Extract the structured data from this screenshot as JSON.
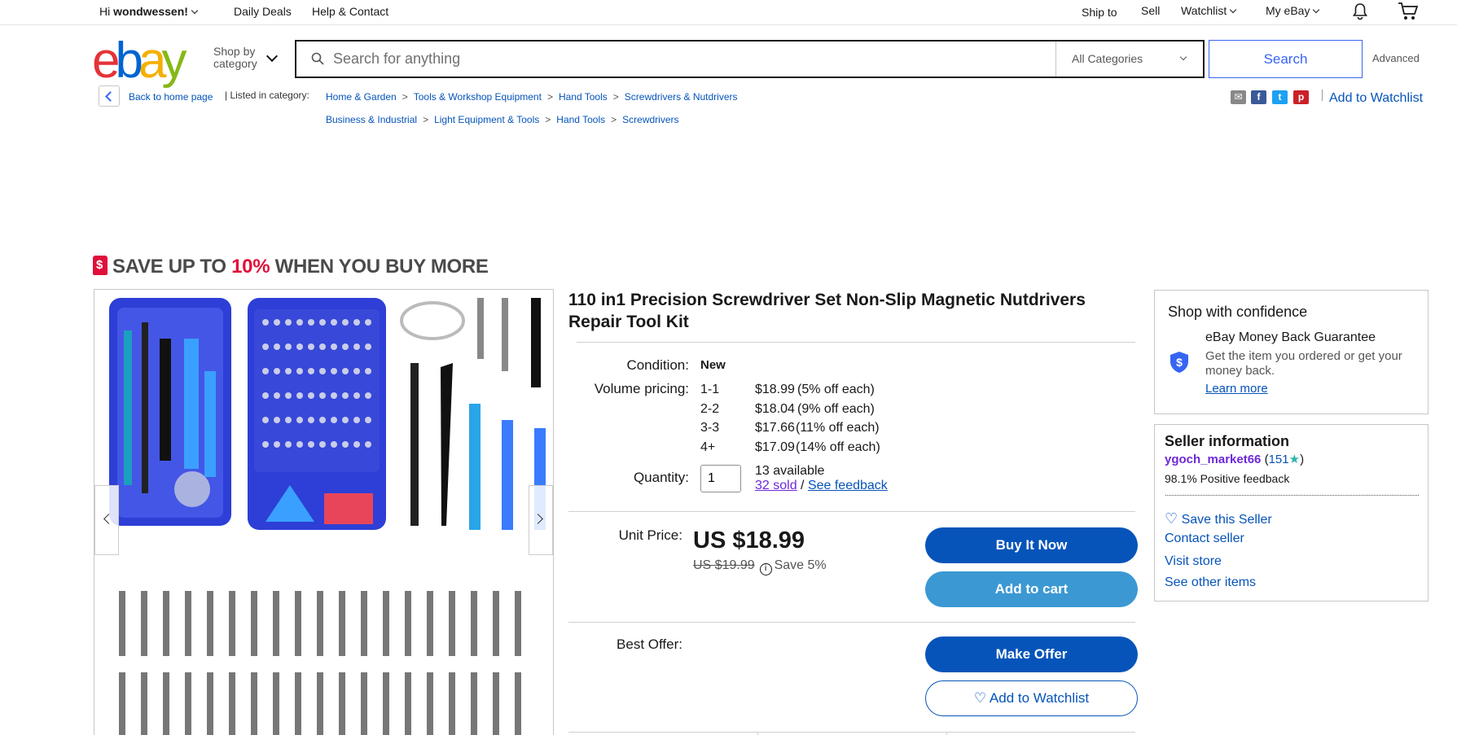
{
  "topnav": {
    "greeting_prefix": "Hi ",
    "username": "wondwessen!",
    "daily_deals": "Daily Deals",
    "help_contact": "Help & Contact",
    "ship_to": "Ship to",
    "sell": "Sell",
    "watchlist": "Watchlist",
    "my_ebay": "My eBay"
  },
  "header": {
    "logo_letters": [
      "e",
      "b",
      "a",
      "y"
    ],
    "logo_colors": [
      "#e53238",
      "#0064d2",
      "#f5af02",
      "#86b817"
    ],
    "shop_by_line1": "Shop by",
    "shop_by_line2": "category",
    "search_placeholder": "Search for anything",
    "category_selected": "All Categories",
    "search_button": "Search",
    "advanced": "Advanced"
  },
  "breadcrumb": {
    "back": "Back to home page",
    "listed_in": "| Listed in category:",
    "row1": [
      "Home & Garden",
      "Tools & Workshop Equipment",
      "Hand Tools",
      "Screwdrivers & Nutdrivers"
    ],
    "row2": [
      "Business & Industrial",
      "Light Equipment & Tools",
      "Hand Tools",
      "Screwdrivers"
    ],
    "separator": ">",
    "add_to_watchlist": "Add to Watchlist"
  },
  "share": {
    "icons": [
      "email-icon",
      "facebook-icon",
      "twitter-icon",
      "pinterest-icon"
    ]
  },
  "promo": {
    "prefix": "SAVE UP TO ",
    "percent": "10%",
    "suffix": " WHEN YOU BUY MORE"
  },
  "product": {
    "title": "110 in1 Precision Screwdriver Set Non-Slip Magnetic Nutdrivers Repair Tool Kit",
    "condition_label": "Condition:",
    "condition_value": "New",
    "volume_label": "Volume pricing:",
    "volume_pricing": [
      {
        "qty": "1-1",
        "price": "$18.99",
        "off": "(5% off each)"
      },
      {
        "qty": "2-2",
        "price": "$18.04",
        "off": "(9% off each)"
      },
      {
        "qty": "3-3",
        "price": "$17.66",
        "off": "(11% off each)"
      },
      {
        "qty": "4+",
        "price": "$17.09",
        "off": "(14% off each)"
      }
    ],
    "quantity_label": "Quantity:",
    "quantity_value": "1",
    "available": "13 available",
    "sold": "32 sold",
    "sold_sep": " / ",
    "see_feedback": "See feedback",
    "unit_price_label": "Unit Price:",
    "price": "US $18.99",
    "was_price": "US $19.99",
    "save": "Save 5%",
    "buy_now": "Buy It Now",
    "add_to_cart": "Add to cart",
    "best_offer_label": "Best Offer:",
    "make_offer": "Make Offer",
    "add_to_watchlist": "Add to Watchlist"
  },
  "confidence": {
    "title": "Shop with confidence",
    "guarantee_title": "eBay Money Back Guarantee",
    "guarantee_text": "Get the item you ordered or get your money back.",
    "learn_more": "Learn more"
  },
  "seller": {
    "title": "Seller information",
    "name": "ygoch_market66",
    "score_open": " (",
    "score": "151",
    "score_close": ")",
    "feedback": "98.1% Positive feedback",
    "save_seller": "Save this Seller",
    "contact": "Contact seller",
    "visit_store": "Visit store",
    "other_items": "See other items"
  },
  "colors": {
    "accent_blue": "#3665f3",
    "link_blue": "#0654ba",
    "promo_red": "#e0103a",
    "cart_blue": "#3b98d2"
  }
}
